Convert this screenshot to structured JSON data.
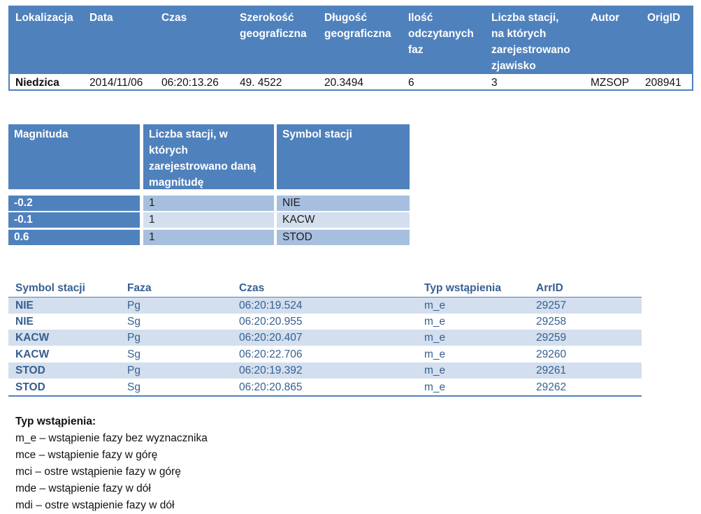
{
  "event": {
    "headers": [
      "Lokalizacja",
      "Data",
      "Czas",
      "Szerokość\ngeograficzna",
      "Długość\ngeograficzna",
      "Ilość\nodczytanych\nfaz",
      "Liczba stacji,\nna których\nzarejestrowano\nzjawisko",
      "Autor",
      "OrigID"
    ],
    "row": [
      "Niedzica",
      "2014/11/06",
      "06:20:13.26",
      "49. 4522",
      "20.3494",
      "6",
      "3",
      "MZSOP",
      "208941"
    ]
  },
  "magnitude": {
    "headers": [
      "Magnituda",
      "Liczba stacji, w\nktórych\nzarejestrowano daną\nmagnitudę",
      "Symbol stacji"
    ],
    "rows": [
      [
        "-0.2",
        "1",
        "NIE"
      ],
      [
        "-0.1",
        "1",
        "KACW"
      ],
      [
        "0.6",
        "1",
        "STOD"
      ]
    ]
  },
  "phases": {
    "headers": [
      "Symbol stacji",
      "Faza",
      "Czas",
      "Typ wstąpienia",
      "ArrID"
    ],
    "rows": [
      [
        "NIE",
        "Pg",
        "06:20:19.524",
        "m_e",
        "29257"
      ],
      [
        "NIE",
        "Sg",
        "06:20:20.955",
        "m_e",
        "29258"
      ],
      [
        "KACW",
        "Pg",
        "06:20:20.407",
        "m_e",
        "29259"
      ],
      [
        "KACW",
        "Sg",
        "06:20:22.706",
        "m_e",
        "29260"
      ],
      [
        "STOD",
        "Pg",
        "06:20:19.392",
        "m_e",
        "29261"
      ],
      [
        "STOD",
        "Sg",
        "06:20:20.865",
        "m_e",
        "29262"
      ]
    ]
  },
  "legend": {
    "title": "Typ wstąpienia:",
    "items": [
      "m_e – wstąpienie fazy bez wyznacznika",
      "mce – wstąpienie fazy w górę",
      "mci – ostre wstąpienie fazy w górę",
      "mde – wstąpienie fazy w dół",
      "mdi – ostre wstąpienie fazy w dół"
    ]
  },
  "colors": {
    "header_blue": "#4f81bd",
    "band_dark": "#a7bfde",
    "band_light": "#d3dfee",
    "text_blue": "#365f91"
  }
}
